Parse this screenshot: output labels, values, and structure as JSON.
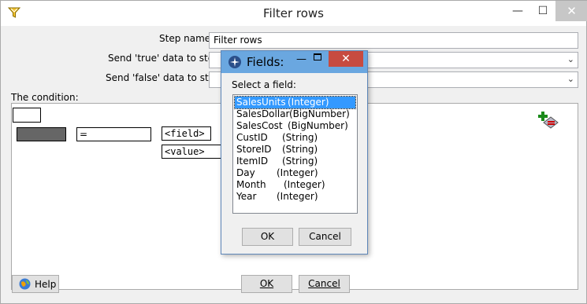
{
  "window": {
    "title": "Filter rows",
    "close_glyph": "✕",
    "min_glyph": "—",
    "max_glyph": "☐"
  },
  "form": {
    "step_name_label": "Step name",
    "step_name_value": "Filter rows",
    "true_label": "Send 'true' data to step:",
    "false_label": "Send 'false' data to step:",
    "condition_label": "The condition:"
  },
  "condition": {
    "operator": "=",
    "field_placeholder": "<field>",
    "value_placeholder": "<value>"
  },
  "buttons": {
    "help": "Help",
    "ok": "OK",
    "cancel": "Cancel"
  },
  "fields_dialog": {
    "title": "Fields:",
    "select_label": "Select a field:",
    "items": [
      {
        "name": "SalesUnits",
        "type": "(Integer)"
      },
      {
        "name": "SalesDollar",
        "type": "(BigNumber)"
      },
      {
        "name": "SalesCost",
        "type": "(BigNumber)"
      },
      {
        "name": "CustID",
        "type": "(String)"
      },
      {
        "name": "StoreID",
        "type": "(String)"
      },
      {
        "name": "ItemID",
        "type": "(String)"
      },
      {
        "name": "Day",
        "type": "(Integer)"
      },
      {
        "name": "Month",
        "type": "(Integer)"
      },
      {
        "name": "Year",
        "type": "(Integer)"
      }
    ],
    "ok": "OK",
    "cancel": "Cancel"
  },
  "icons": {
    "app": "filter-funnel-icon",
    "help": "help-globe-icon",
    "add_condition": "add-condition-icon",
    "fields_dialog": "fields-dialog-icon"
  },
  "colors": {
    "selection": "#3399ff",
    "dialog_titlebar": "#6aa7e0",
    "close": "#c74b40"
  }
}
